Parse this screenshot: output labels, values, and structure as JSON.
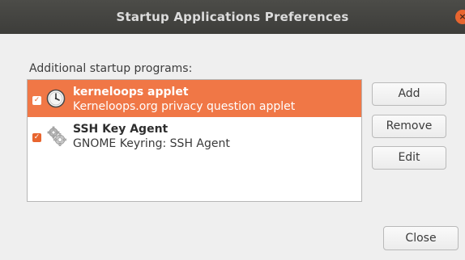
{
  "window": {
    "title": "Startup Applications Preferences",
    "close_glyph": "×"
  },
  "section_label": "Additional startup programs:",
  "programs": [
    {
      "name": "kerneloops applet",
      "description": "Kerneloops.org privacy question applet",
      "enabled": true,
      "selected": true,
      "icon": "clock-icon"
    },
    {
      "name": "SSH Key Agent",
      "description": "GNOME Keyring: SSH Agent",
      "enabled": true,
      "selected": false,
      "icon": "gears-icon"
    }
  ],
  "buttons": {
    "add": "Add",
    "remove": "Remove",
    "edit": "Edit",
    "close": "Close"
  },
  "colors": {
    "accent": "#f07746",
    "titlebar": "#3d3d3a",
    "close_button": "#e8652f"
  }
}
